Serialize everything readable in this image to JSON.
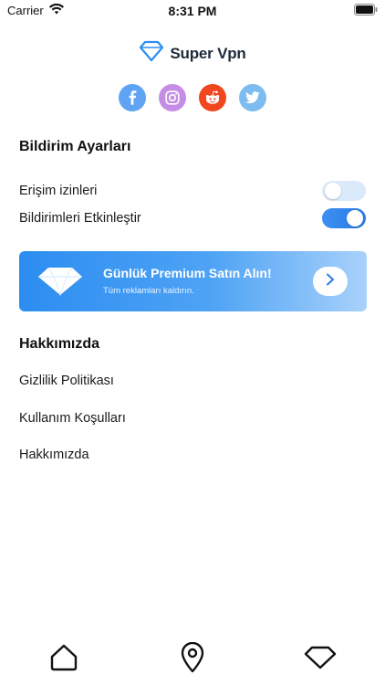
{
  "status_bar": {
    "carrier": "Carrier",
    "time": "8:31 PM"
  },
  "brand": {
    "name": "Super Vpn"
  },
  "socials": [
    "facebook-icon",
    "instagram-icon",
    "reddit-icon",
    "twitter-icon"
  ],
  "notification_settings": {
    "title": "Bildirim Ayarları",
    "access_permissions": {
      "label": "Erişim izinleri",
      "enabled": false
    },
    "enable_notifications": {
      "label": "Bildirimleri Etkinleştir",
      "enabled": true
    }
  },
  "promo": {
    "title": "Günlük Premium Satın Alın!",
    "subtitle": "Tüm reklamları kaldırın."
  },
  "about": {
    "title": "Hakkımızda",
    "links": [
      "Gizlilik Politikası",
      "Kullanım Koşulları",
      "Hakkımızda"
    ]
  },
  "tabbar": [
    "home-icon",
    "location-pin-icon",
    "diamond-icon"
  ],
  "colors": {
    "accent": "#2a7be6",
    "facebook": "#5fa4f3",
    "instagram": "#c58de6",
    "reddit": "#f0471f",
    "twitter": "#7dbcf0"
  }
}
